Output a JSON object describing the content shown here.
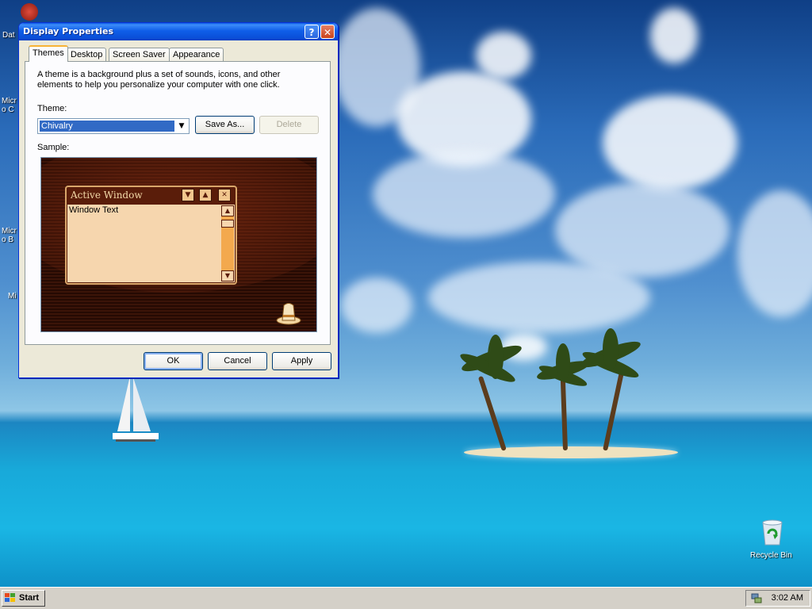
{
  "desktop": {
    "icons": [
      {
        "label": "Dat"
      },
      {
        "label": "Micro C"
      },
      {
        "label": "Micro B"
      },
      {
        "label": "Mi"
      }
    ],
    "recycle_bin_label": "Recycle Bin"
  },
  "dialog": {
    "title": "Display Properties",
    "help_symbol": "?",
    "close_symbol": "✕",
    "tabs": [
      {
        "label": "Themes",
        "active": true
      },
      {
        "label": "Desktop",
        "active": false
      },
      {
        "label": "Screen Saver",
        "active": false
      },
      {
        "label": "Appearance",
        "active": false
      }
    ],
    "description": "A theme is a background plus a set of sounds, icons, and other elements to help you personalize your computer with one click.",
    "theme_label": "Theme:",
    "theme_value": "Chivalry",
    "save_as_label": "Save As...",
    "delete_label": "Delete",
    "sample_label": "Sample:",
    "sample_window_title": "Active Window",
    "sample_window_text": "Window Text",
    "ok_label": "OK",
    "cancel_label": "Cancel",
    "apply_label": "Apply"
  },
  "taskbar": {
    "start_label": "Start",
    "clock": "3:02 AM"
  },
  "colors": {
    "title_bar": "#0a4fd8",
    "dialog_face": "#ece9d8",
    "sample_background": "#3b1408",
    "sample_client": "#f6d6ae"
  }
}
